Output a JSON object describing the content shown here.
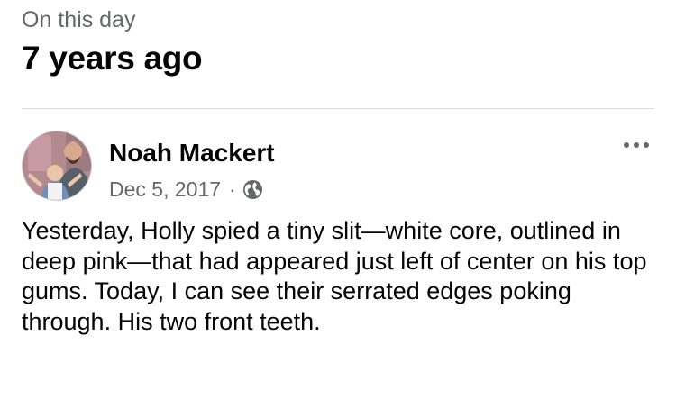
{
  "memories": {
    "label": "On this day",
    "title": "7 years ago"
  },
  "post": {
    "author": "Noah Mackert",
    "date": "Dec 5, 2017",
    "separator": "·",
    "audience_icon": "globe-icon",
    "more_icon": "more-options-icon",
    "text": "Yesterday, Holly spied a tiny slit—white core, outlined in deep pink—that had appeared just left of center on his top gums. Today, I can see their serrated edges poking through. His two front teeth."
  },
  "colors": {
    "primary_text": "#050505",
    "secondary_text": "#65676b",
    "divider": "#dadde1"
  }
}
